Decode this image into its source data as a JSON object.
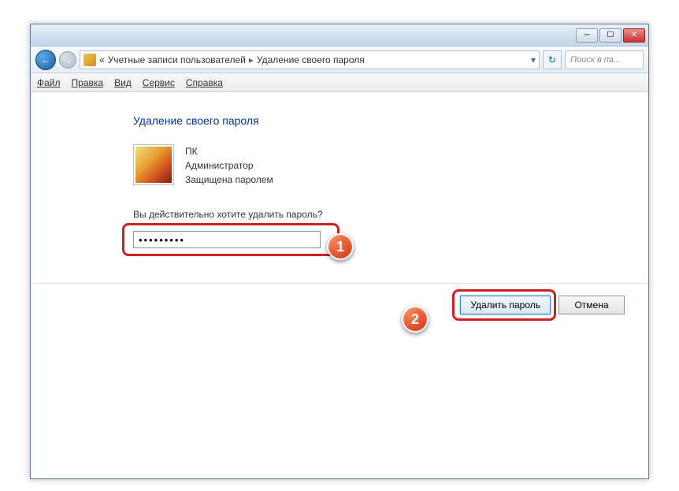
{
  "titlebar": {
    "minimize_glyph": "─",
    "maximize_glyph": "☐",
    "close_glyph": "✕"
  },
  "nav": {
    "back_glyph": "←",
    "forward_glyph": "→",
    "breadcrumb_prefix": "«",
    "breadcrumb_part1": "Учетные записи пользователей",
    "breadcrumb_sep": "▸",
    "breadcrumb_part2": "Удаление своего пароля",
    "dropdown_glyph": "▾",
    "refresh_glyph": "↻",
    "search_placeholder": "Поиск в па..."
  },
  "menu": {
    "file": "Файл",
    "edit": "Правка",
    "view": "Вид",
    "tools": "Сервис",
    "help": "Справка"
  },
  "content": {
    "heading": "Удаление своего пароля",
    "user_name": "ПК",
    "user_role": "Администратор",
    "user_status": "Защищена паролем",
    "prompt": "Вы действительно хотите удалить пароль?",
    "password_value": "•••••••••"
  },
  "buttons": {
    "delete": "Удалить пароль",
    "cancel": "Отмена"
  },
  "markers": {
    "m1": "1",
    "m2": "2"
  }
}
